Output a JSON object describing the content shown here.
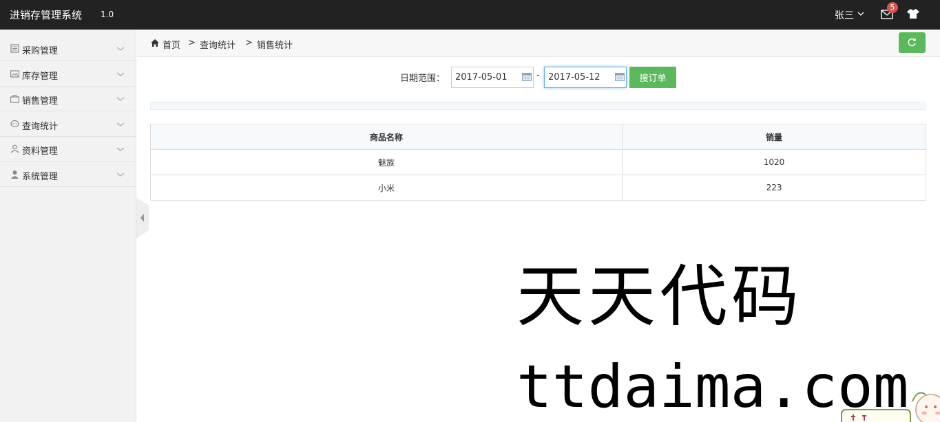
{
  "header": {
    "title": "进销存管理系统",
    "version": "1.0",
    "user": "张三",
    "notification_count": "5"
  },
  "sidebar": {
    "items": [
      {
        "label": "采购管理",
        "icon": "list-icon"
      },
      {
        "label": "库存管理",
        "icon": "image-icon"
      },
      {
        "label": "销售管理",
        "icon": "briefcase-icon"
      },
      {
        "label": "查询统计",
        "icon": "chat-icon"
      },
      {
        "label": "资料管理",
        "icon": "user-outline-icon"
      },
      {
        "label": "系统管理",
        "icon": "user-icon"
      }
    ]
  },
  "breadcrumb": {
    "items": [
      "首页",
      "查询统计",
      "销售统计"
    ],
    "separator": ">"
  },
  "search": {
    "date_range_label": "日期范围：",
    "start_date": "2017-05-01",
    "end_date": "2017-05-12",
    "separator": "-",
    "button_label": "搜订单"
  },
  "table": {
    "columns": [
      "商品名称",
      "销量"
    ],
    "rows": [
      [
        "魅族",
        "1020"
      ],
      [
        "小米",
        "223"
      ]
    ]
  },
  "watermark": {
    "line1": "天天代码",
    "line2": "ttdaima.com"
  },
  "colors": {
    "topbar": "#222222",
    "success": "#5cb85c",
    "badge": "#d9534f"
  }
}
